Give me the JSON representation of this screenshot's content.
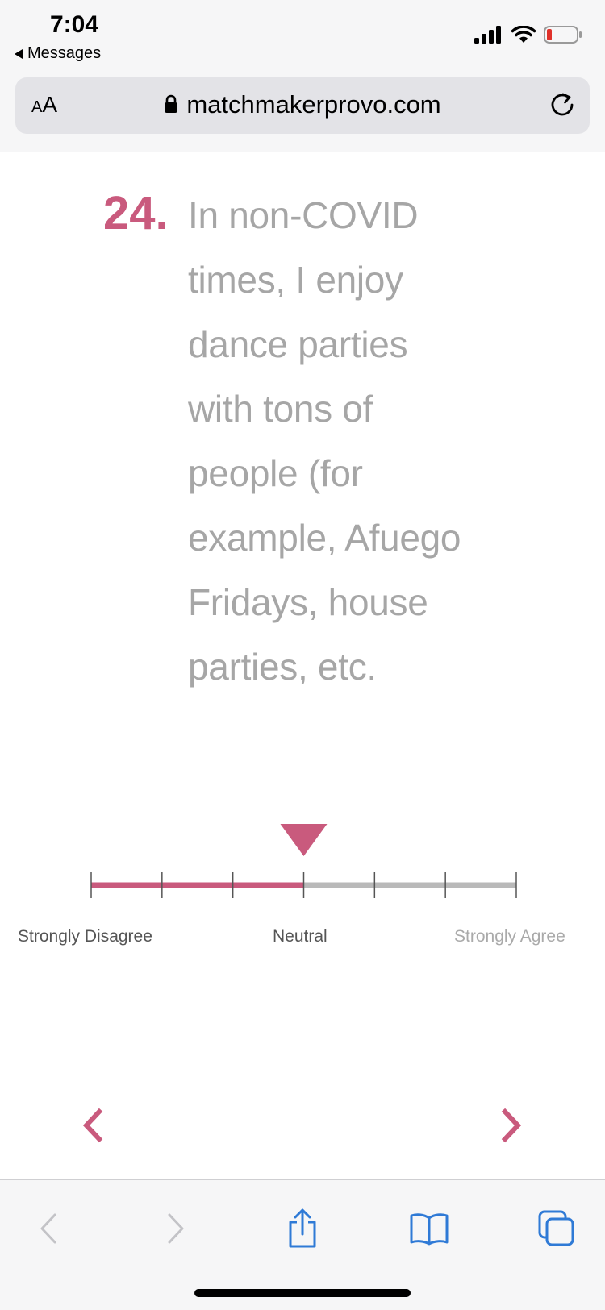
{
  "status_bar": {
    "time": "7:04",
    "back_app": "Messages",
    "icons": [
      "signal-icon",
      "wifi-icon",
      "battery-icon"
    ]
  },
  "browser": {
    "text_size_small": "A",
    "text_size_big": "A",
    "url": "matchmakerprovo.com"
  },
  "question": {
    "number": "24.",
    "lines": [
      "In non-COVID",
      "times, I enjoy",
      "dance parties",
      "with tons of",
      "people (for",
      "example, Afuego",
      "Fridays, house",
      "parties, etc."
    ]
  },
  "scale": {
    "steps": 7,
    "selected_step": 4,
    "label_left": "Strongly Disagree",
    "label_mid": "Neutral",
    "label_right": "Strongly Agree",
    "active_color": "#c95a7d",
    "inactive_color": "#b9b9b9"
  },
  "navigation": {
    "prev_icon": "chevron-left-icon",
    "next_icon": "chevron-right-icon",
    "accent_color": "#c95a7d"
  },
  "toolbar": {
    "icons": [
      "back-icon",
      "forward-icon",
      "share-icon",
      "bookmarks-icon",
      "tabs-icon"
    ],
    "icon_color": "#2f7ad6"
  }
}
